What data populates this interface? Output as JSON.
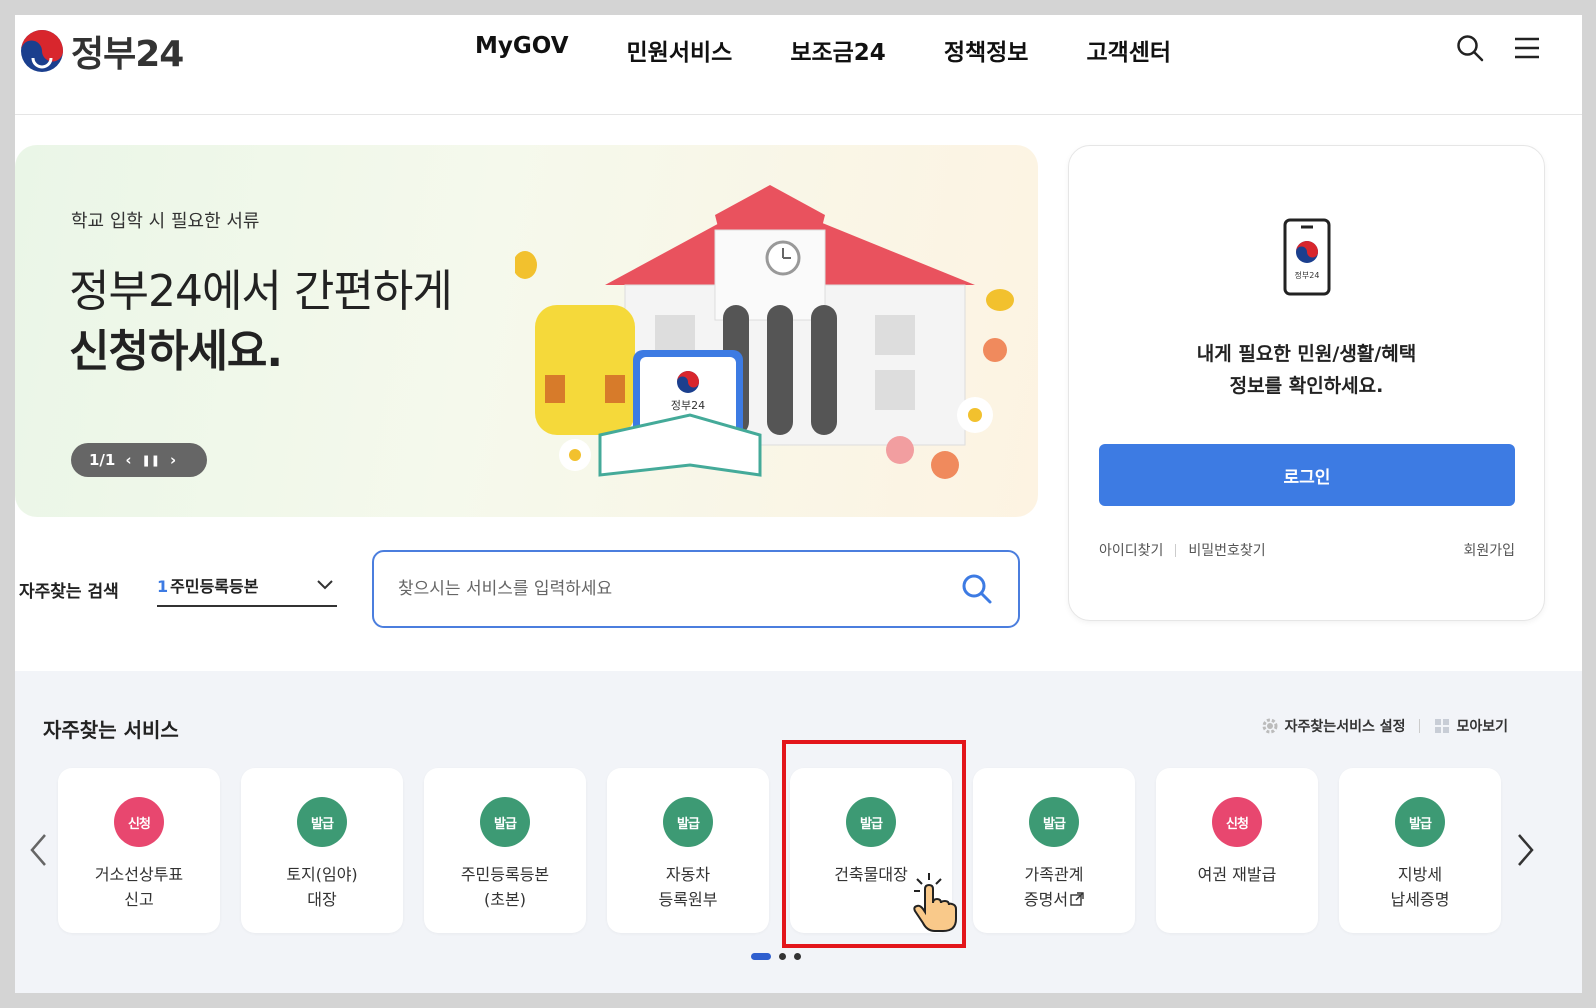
{
  "header": {
    "logo_text": "정부24",
    "nav": [
      "MyGOV",
      "민원서비스",
      "보조금24",
      "정책정보",
      "고객센터"
    ]
  },
  "hero": {
    "subtitle": "학교 입학 시 필요한 서류",
    "title_line1": "정부24에서 간편하게",
    "title_line2": "신청하세요.",
    "pager": "1/1",
    "badge_text": "정부24"
  },
  "login": {
    "phone_label": "정부24",
    "message_line1": "내게 필요한 민원/생활/혜택",
    "message_line2": "정보를 확인하세요.",
    "button": "로그인",
    "find_id": "아이디찾기",
    "find_pw": "비밀번호찾기",
    "join": "회원가입"
  },
  "search": {
    "freq_label": "자주찾는 검색",
    "selected_num": "1",
    "selected_value": "주민등록등본",
    "placeholder": "찾으시는 서비스를 입력하세요"
  },
  "services": {
    "title": "자주찾는 서비스",
    "settings": "자주찾는서비스 설정",
    "view_all": "모아보기",
    "items": [
      {
        "badge": "신청",
        "color": "pink",
        "line1": "거소선상투표",
        "line2": "신고"
      },
      {
        "badge": "발급",
        "color": "green",
        "line1": "토지(임야)",
        "line2": "대장"
      },
      {
        "badge": "발급",
        "color": "green",
        "line1": "주민등록등본",
        "line2": "(초본)"
      },
      {
        "badge": "발급",
        "color": "green",
        "line1": "자동차",
        "line2": "등록원부"
      },
      {
        "badge": "발급",
        "color": "green",
        "line1": "건축물대장",
        "line2": ""
      },
      {
        "badge": "발급",
        "color": "green",
        "line1": "가족관계",
        "line2": "증명서"
      },
      {
        "badge": "신청",
        "color": "pink",
        "line1": "여권 재발급",
        "line2": ""
      },
      {
        "badge": "발급",
        "color": "green",
        "line1": "지방세",
        "line2": "납세증명"
      }
    ]
  },
  "colors": {
    "primary": "#3d7be3",
    "badge_green": "#3d9a74",
    "badge_pink": "#e8476f",
    "highlight": "#e3151b"
  }
}
